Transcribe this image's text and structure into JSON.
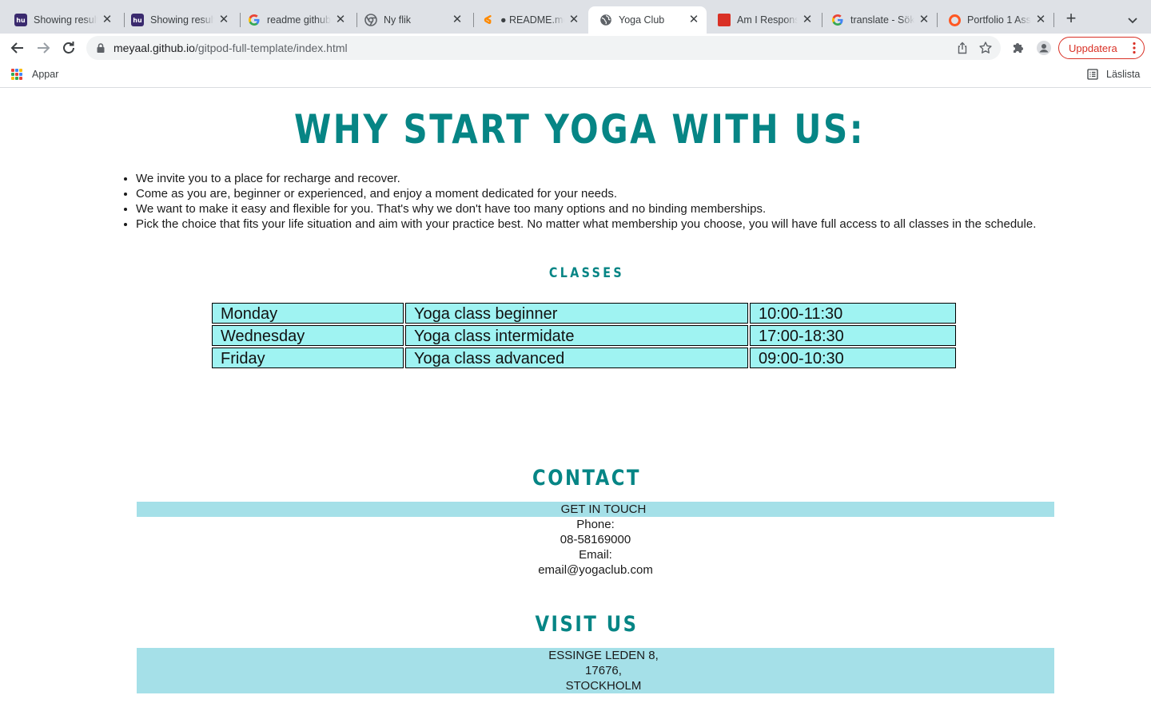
{
  "browser": {
    "tabs": [
      {
        "title": "Showing results",
        "icon": "hu-icon"
      },
      {
        "title": "Showing results",
        "icon": "hu-icon"
      },
      {
        "title": "readme github",
        "icon": "google-icon"
      },
      {
        "title": "Ny flik",
        "icon": "chrome-icon"
      },
      {
        "title": "● README.md",
        "icon": "gitpod-icon"
      },
      {
        "title": "Yoga Club",
        "icon": "globe-icon",
        "active": true
      },
      {
        "title": "Am I Responsive",
        "icon": "am-i-responsive-icon"
      },
      {
        "title": "translate - Sök",
        "icon": "google-icon"
      },
      {
        "title": "Portfolio 1 Ass",
        "icon": "ring-icon"
      }
    ],
    "address": {
      "domain": "meyaal.github.io",
      "path": "/gitpod-full-template/index.html"
    },
    "update_label": "Uppdatera",
    "bookmarks": {
      "apps_label": "Appar",
      "reading_list_label": "Läslista"
    },
    "colors": {
      "chrome_bg": "#dee1e6",
      "update_red": "#d93025"
    }
  },
  "page": {
    "why_title": "WHY START YOGA WITH US:",
    "reasons": [
      "We invite you to a place for recharge and recover.",
      "Come as you are, beginner or experienced, and enjoy a moment dedicated for your needs.",
      "We want to make it easy and flexible for you. That's why we don't have too many options and no binding memberships.",
      "Pick the choice that fits your life situation and aim with your practice best. No matter what membership you choose, you will have full access to all classes in the schedule."
    ],
    "classes_heading": "CLASSES",
    "schedule": [
      {
        "day": "Monday",
        "class": "Yoga class beginner",
        "time": "10:00-11:30"
      },
      {
        "day": "Wednesday",
        "class": "Yoga class intermidate",
        "time": "17:00-18:30"
      },
      {
        "day": "Friday",
        "class": "Yoga class advanced",
        "time": "09:00-10:30"
      }
    ],
    "contact_heading": "CONTACT",
    "contact": {
      "get_in_touch": "GET IN TOUCH",
      "phone_label": "Phone:",
      "phone": "08-58169000",
      "email_label": "Email:",
      "email": "email@yogaclub.com"
    },
    "visit_heading": "VISIT US",
    "address": {
      "street": "ESSINGE LEDEN 8,",
      "postcode": "17676,",
      "city": "STOCKHOLM"
    },
    "colors": {
      "heading_teal": "#068585",
      "table_cyan": "#9ff3f2",
      "band_blue": "#a5e0e8"
    }
  }
}
